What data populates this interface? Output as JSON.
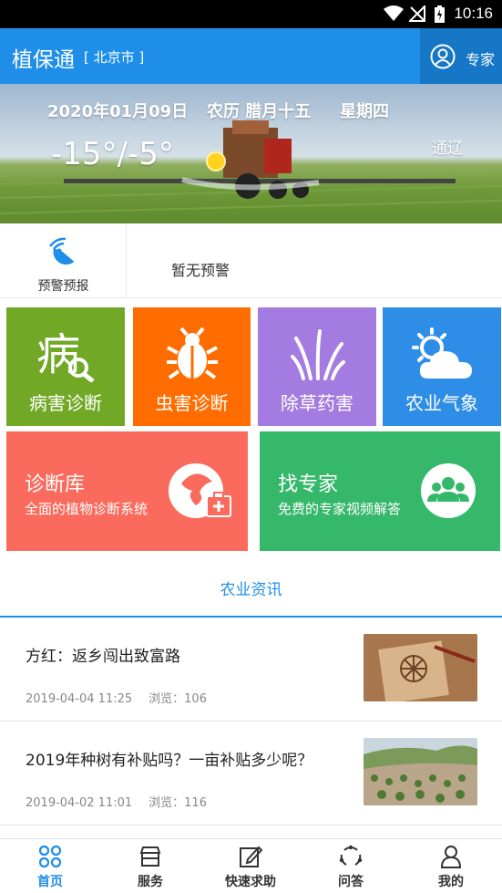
{
  "status_bar": {
    "time": "10:16",
    "icons": [
      "wifi-icon",
      "no-signal-icon",
      "battery-charging-icon"
    ]
  },
  "app_bar": {
    "title": "植保通",
    "city": "[ 北京市 ]",
    "expert_label": "专家",
    "expert_icon": "user-circle-icon"
  },
  "weather": {
    "date": "2020年01月09日",
    "lunar": "农历 腊月十五",
    "weekday": "星期四",
    "temperature": "-15°/-5°",
    "location": "通辽"
  },
  "warning": {
    "label": "预警预报",
    "icon": "radar-icon",
    "message": "暂无预警"
  },
  "tiles": [
    {
      "label": "病害诊断",
      "color": "#71a825",
      "icon": "disease-icon"
    },
    {
      "label": "虫害诊断",
      "color": "#ff6d00",
      "icon": "bug-icon"
    },
    {
      "label": "除草药害",
      "color": "#a47be0",
      "icon": "grass-icon"
    },
    {
      "label": "农业气象",
      "color": "#2e8de6",
      "icon": "weather-icon"
    }
  ],
  "big_tiles": [
    {
      "title": "诊断库",
      "subtitle": "全面的植物诊断系统",
      "color": "#fa6b5d",
      "icon": "plant-diagnosis-icon"
    },
    {
      "title": "找专家",
      "subtitle": "免费的专家视频解答",
      "color": "#35b86a",
      "icon": "experts-group-icon"
    }
  ],
  "news_section_title": "农业资讯",
  "news": [
    {
      "headline": "方红：返乡闯出致富路",
      "date": "2019-04-04 11:25",
      "views": "浏览：106"
    },
    {
      "headline": "2019年种树有补贴吗？一亩补贴多少呢？",
      "date": "2019-04-02 11:01",
      "views": "浏览：116"
    }
  ],
  "tabs": [
    {
      "label": "首页",
      "icon": "home-grid-icon"
    },
    {
      "label": "服务",
      "icon": "store-icon"
    },
    {
      "label": "快速求助",
      "icon": "edit-icon"
    },
    {
      "label": "问答",
      "icon": "qa-icon"
    },
    {
      "label": "我的",
      "icon": "profile-icon"
    }
  ],
  "colors": {
    "primary": "#1e8ee8",
    "primary_dark": "#1677c6"
  }
}
